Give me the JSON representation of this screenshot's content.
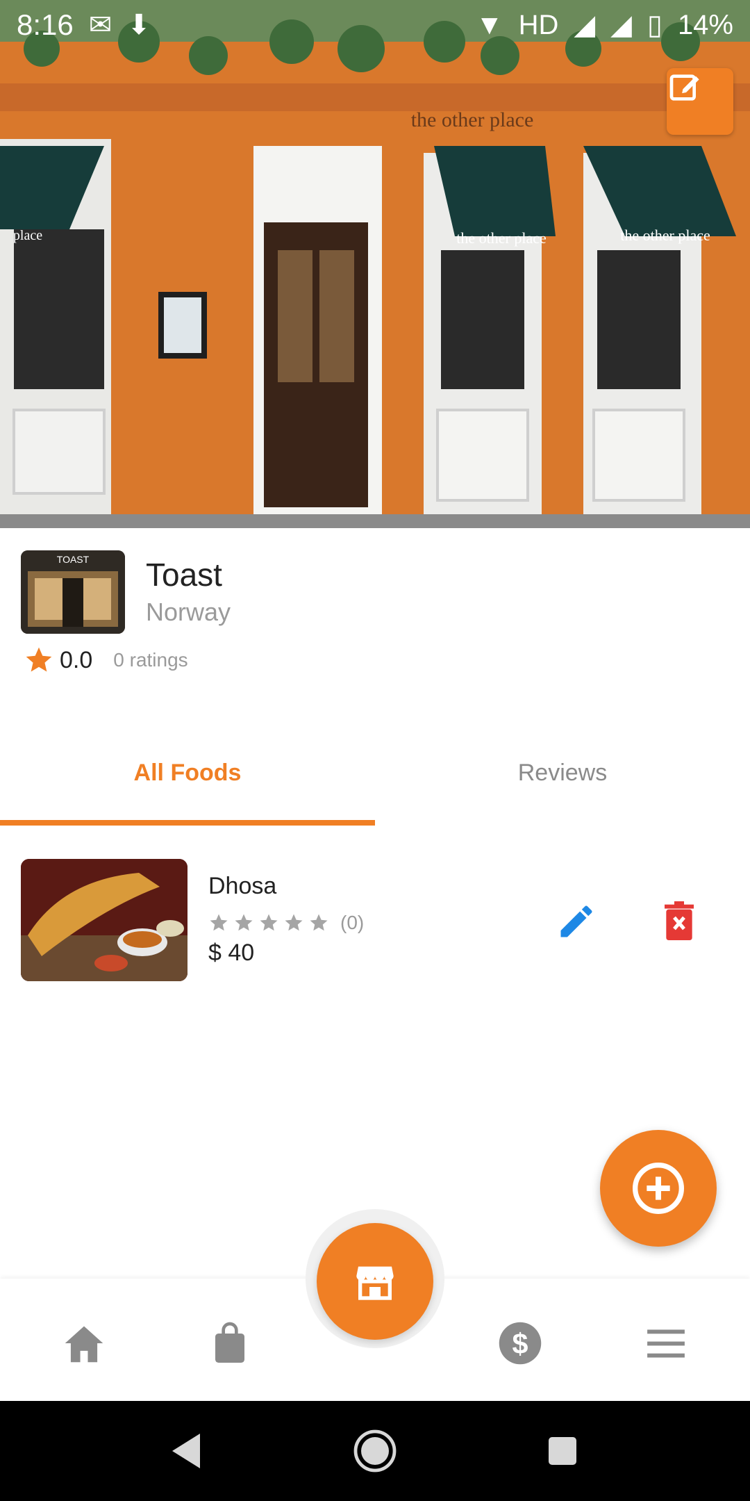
{
  "status_bar": {
    "time": "8:16",
    "network": "HD",
    "battery": "14%"
  },
  "hero": {
    "sign_text": "the other place",
    "awning_text_left": "the other place",
    "awning_text_right": "the other place",
    "awning_text_edge": "place"
  },
  "thumb": {
    "label": "TOAST"
  },
  "restaurant": {
    "name": "Toast",
    "location": "Norway",
    "rating": "0.0",
    "ratings_count": "0 ratings"
  },
  "tabs": [
    {
      "label": "All Foods"
    },
    {
      "label": "Reviews"
    }
  ],
  "foods": [
    {
      "name": "Dhosa",
      "review_count": "(0)",
      "price": "$ 40"
    }
  ],
  "colors": {
    "accent": "#f07f24",
    "edit_blue": "#1e88e5",
    "delete_red": "#e53935",
    "nav_gray": "#8a8a8a"
  },
  "icons": {
    "edit_cover": "edit-square-icon",
    "star": "star-icon",
    "edit_food": "pencil-icon",
    "delete_food": "trash-icon",
    "add": "plus-circle-icon",
    "store": "store-icon",
    "home": "home-icon",
    "bag": "shopping-bag-icon",
    "dollar": "dollar-icon",
    "menu": "menu-icon"
  }
}
